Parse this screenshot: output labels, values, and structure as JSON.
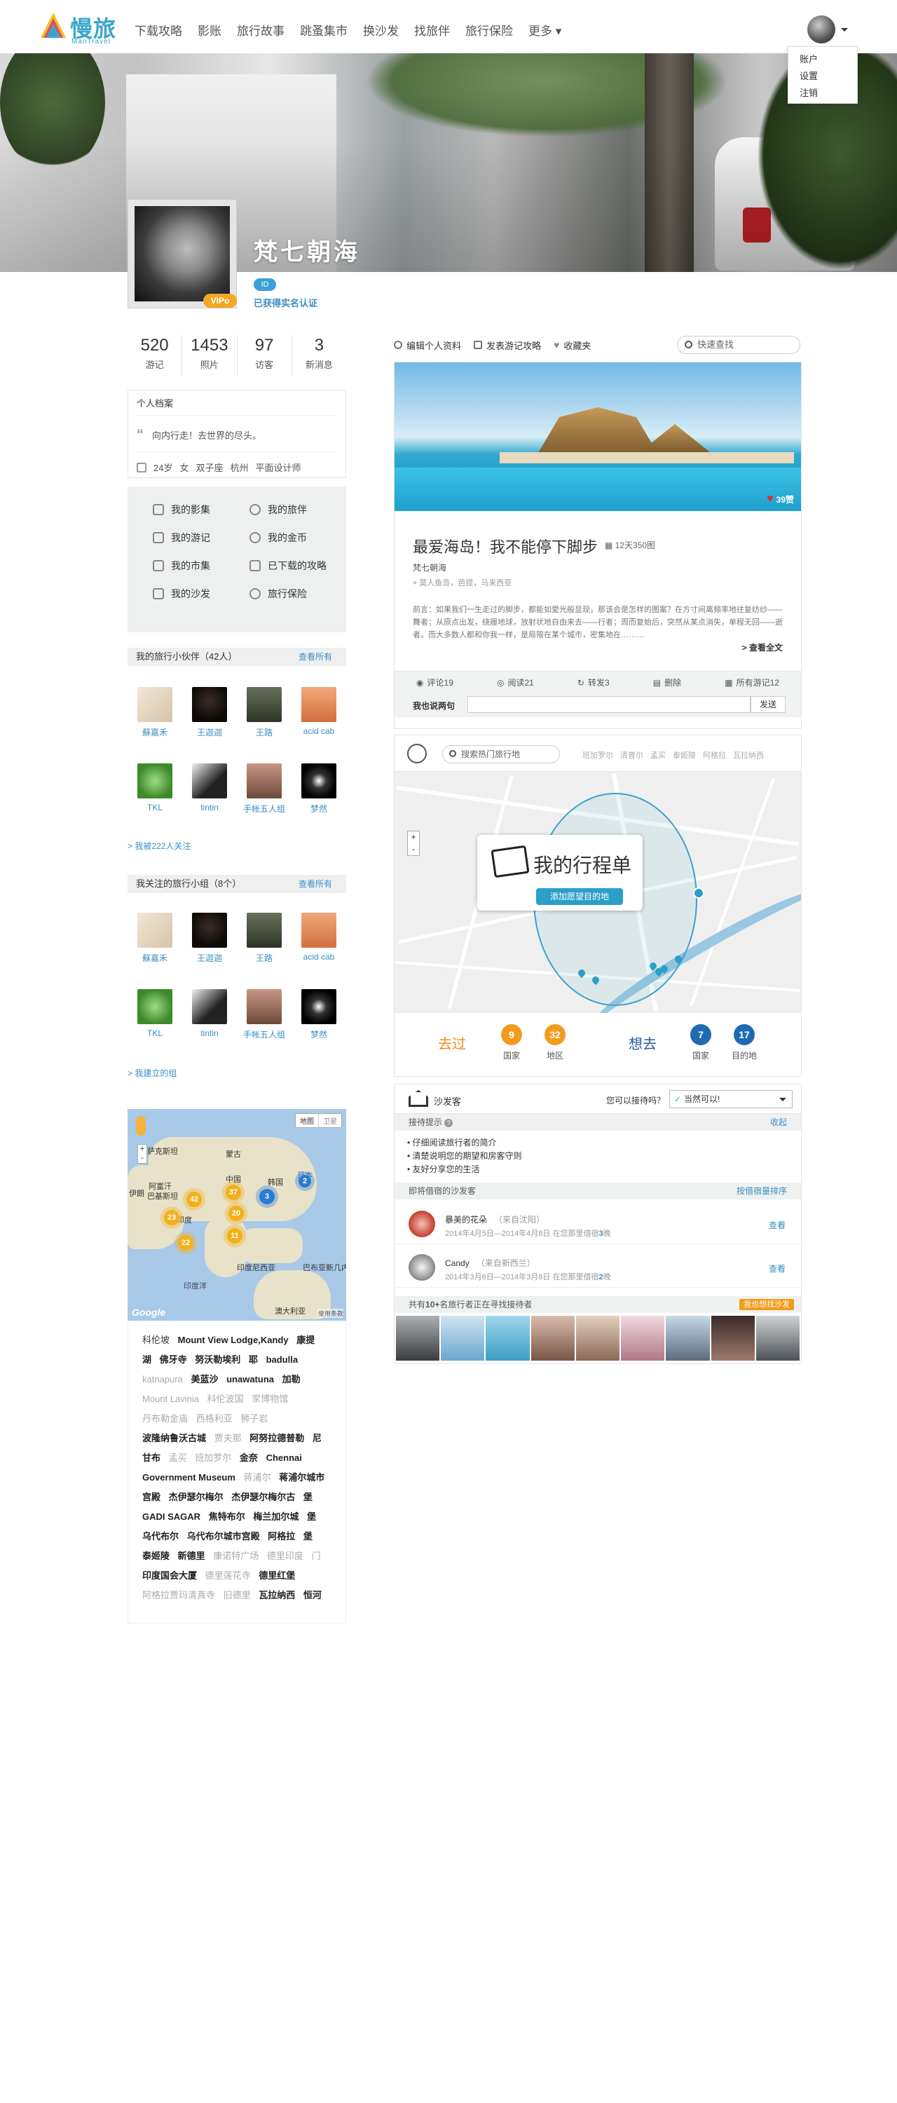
{
  "header": {
    "brand": "慢旅",
    "brand_sub": "ManTravel",
    "nav": [
      "下载攻略",
      "影账",
      "旅行故事",
      "跳蚤集市",
      "换沙发",
      "找旅伴",
      "旅行保险"
    ],
    "more": "更多",
    "user_menu": [
      "账户",
      "设置",
      "注销"
    ]
  },
  "profile": {
    "name": "梵七朝海",
    "vip": "VIPo",
    "id_badge": "ID",
    "verified": "已获得实名认证",
    "stats": [
      {
        "value": "520",
        "label": "游记"
      },
      {
        "value": "1453",
        "label": "照片"
      },
      {
        "value": "97",
        "label": "访客"
      },
      {
        "value": "3",
        "label": "新消息"
      }
    ],
    "archive_title": "个人档案",
    "motto": "向内行走！去世界的尽头。",
    "meta": [
      "24岁",
      "女",
      "双子座",
      "杭州",
      "平面设计师"
    ]
  },
  "menu": [
    {
      "label": "我的影集"
    },
    {
      "label": "我的旅伴"
    },
    {
      "label": "我的游记"
    },
    {
      "label": "我的金币"
    },
    {
      "label": "我的市集"
    },
    {
      "label": "已下载的攻略"
    },
    {
      "label": "我的沙发"
    },
    {
      "label": "旅行保险"
    }
  ],
  "partners": {
    "title": "我的旅行小伙伴（42人）",
    "more": "查看所有",
    "people": [
      "蘇嘉禾",
      "王迦迦",
      "王路",
      "acid cab",
      "TKL",
      "tintin",
      "手帐五人组",
      "梦然"
    ],
    "follow_link": "> 我被222人关注"
  },
  "groups": {
    "title": "我关注的旅行小组（8个）",
    "more": "查看所有",
    "people": [
      "蘇嘉禾",
      "王迦迦",
      "王路",
      "acid cab",
      "TKL",
      "tintin",
      "手帐五人组",
      "梦然"
    ],
    "follow_link": "> 我建立的组"
  },
  "worldmap": {
    "controls": [
      "地图",
      "卫星"
    ],
    "labels": [
      "萨克斯坦",
      "蒙古",
      "中国",
      "韩国",
      "日本",
      "阿富汗",
      "巴基斯坦",
      "伊朗",
      "印度",
      "印度尼西亚",
      "巴布亚新几内亚",
      "印度洋",
      "澳大利亚"
    ],
    "clusters": [
      "42",
      "37",
      "3",
      "2",
      "23",
      "20",
      "11",
      "22"
    ],
    "google": "Google",
    "terms": "使用条款"
  },
  "places": [
    {
      "t": "科伦坡",
      "s": "n"
    },
    {
      "t": "Mount View Lodge,Kandy",
      "s": "b"
    },
    {
      "t": "康提",
      "s": "b"
    },
    {
      "t": "湖",
      "s": "b"
    },
    {
      "t": "佛牙寺",
      "s": "b"
    },
    {
      "t": "努沃勒埃利",
      "s": "b"
    },
    {
      "t": "耶",
      "s": "b"
    },
    {
      "t": "badulla",
      "s": "b"
    },
    {
      "t": "katnapura",
      "s": "g"
    },
    {
      "t": "美蓝沙",
      "s": "b"
    },
    {
      "t": "unawatuna",
      "s": "b"
    },
    {
      "t": "加勒",
      "s": "b"
    },
    {
      "t": "Mount Lavinia",
      "s": "g"
    },
    {
      "t": "科伦波国",
      "s": "g"
    },
    {
      "t": "家博物馆",
      "s": "g"
    },
    {
      "t": "丹布勒金庙",
      "s": "g"
    },
    {
      "t": "西格利亚",
      "s": "g"
    },
    {
      "t": "狮子岩",
      "s": "g"
    },
    {
      "t": "波隆纳鲁沃古城",
      "s": "b"
    },
    {
      "t": "贾夫那",
      "s": "g"
    },
    {
      "t": "阿努拉德普勒",
      "s": "b"
    },
    {
      "t": "尼",
      "s": "b"
    },
    {
      "t": "甘布",
      "s": "b"
    },
    {
      "t": "孟买",
      "s": "g"
    },
    {
      "t": "班加罗尔",
      "s": "g"
    },
    {
      "t": "金奈",
      "s": "b"
    },
    {
      "t": "Chennai",
      "s": "b"
    },
    {
      "t": "Government Museum",
      "s": "b"
    },
    {
      "t": "蒋浦尔",
      "s": "g"
    },
    {
      "t": "蒋浦尔城市",
      "s": "b"
    },
    {
      "t": "宫殿",
      "s": "b"
    },
    {
      "t": "杰伊瑟尔梅尔",
      "s": "b"
    },
    {
      "t": "杰伊瑟尔梅尔古",
      "s": "b"
    },
    {
      "t": "堡",
      "s": "b"
    },
    {
      "t": "GADI SAGAR",
      "s": "b"
    },
    {
      "t": "焦特布尔",
      "s": "b"
    },
    {
      "t": "梅兰加尔城",
      "s": "b"
    },
    {
      "t": "堡",
      "s": "b"
    },
    {
      "t": "乌代布尔",
      "s": "b"
    },
    {
      "t": "乌代布尔城市宫殿",
      "s": "b"
    },
    {
      "t": "阿格拉",
      "s": "b"
    },
    {
      "t": "堡",
      "s": "b"
    },
    {
      "t": "泰姬陵",
      "s": "b"
    },
    {
      "t": "新德里",
      "s": "b"
    },
    {
      "t": "康诺特广场",
      "s": "g"
    },
    {
      "t": "德里印度",
      "s": "g"
    },
    {
      "t": "门",
      "s": "g"
    },
    {
      "t": "印度国会大厦",
      "s": "b"
    },
    {
      "t": "德里莲花寺",
      "s": "g"
    },
    {
      "t": "德里红堡",
      "s": "b"
    },
    {
      "t": "阿格拉贾玛清真寺",
      "s": "g"
    },
    {
      "t": "旧德里",
      "s": "g"
    },
    {
      "t": "瓦拉纳西",
      "s": "b"
    },
    {
      "t": "恒河",
      "s": "b"
    }
  ],
  "toolbar": {
    "items": [
      "编辑个人资料",
      "发表游记攻略",
      "收藏夹"
    ],
    "search_placeholder": "快速查找"
  },
  "post": {
    "likes": "39赞",
    "title": "最爱海岛！我不能停下脚步",
    "count": "12天350图",
    "author": "梵七朝海",
    "location": "莫人鱼岛，芭提，马来西亚",
    "excerpt": "前言：如果我们一生走过的脚步，都能如愛光般显现，那该会是怎样的图案？在方寸间离频率地往复纺纱——舞者；从原点出发，绕履地球，放射状地自由来去——行者；周而复始后，突然从某点消失，单程无回——逝者。而大多数人都和你我一样，是局限在某个城市，密集地在………",
    "read_all": "> 查看全文",
    "actions": [
      "评论19",
      "阅读21",
      "转发3",
      "删除",
      "所有游记12"
    ],
    "comment_label": "我也说两句",
    "send": "发送"
  },
  "route": {
    "search_placeholder": "搜索热门旅行地",
    "hot": [
      "班加罗尔",
      "清普尔",
      "孟买",
      "泰姬陵",
      "阿格拉",
      "瓦拉纳西"
    ],
    "trip_title": "我的行程单",
    "add_button": "添加愿望目的地",
    "been_label": "去过",
    "been": [
      {
        "value": "9",
        "label": "国家"
      },
      {
        "value": "32",
        "label": "地区"
      }
    ],
    "want_label": "想去",
    "want": [
      {
        "value": "7",
        "label": "国家"
      },
      {
        "value": "17",
        "label": "目的地"
      }
    ],
    "zoom": [
      "+",
      "-"
    ]
  },
  "sofa": {
    "title": "沙发客",
    "question": "您可以接待吗？",
    "answer": "当然可以!",
    "tips_title": "接待提示",
    "collapse": "收起",
    "tips": [
      "仔细阅读旅行者的简介",
      "清楚说明您的期望和房客守则",
      "友好分享您的生活"
    ],
    "upcoming_title": "即将借宿的沙发客",
    "sort": "按借宿量排序",
    "guests": [
      {
        "name": "暴美的花朵",
        "from": "（来自沈阳）",
        "dates": "2014年4月5日—2014年4月8日 在您那里借宿",
        "nights": "3",
        "unit": "晚",
        "view": "查看"
      },
      {
        "name": "Candy",
        "from": "（来自新西兰）",
        "dates": "2014年3月6日—2014年3月8日 在您那里借宿",
        "nights": "2",
        "unit": "晚",
        "view": "查看"
      }
    ],
    "seekers_pre": "共有",
    "seekers_count": "10+",
    "seekers_post": "名旅行者正在寻找接待者",
    "seekers_cta": "我也想找沙发"
  },
  "colors": {
    "accent": "#3a8ec4",
    "orange": "#f39b1b",
    "navy": "#1f6ab3"
  }
}
